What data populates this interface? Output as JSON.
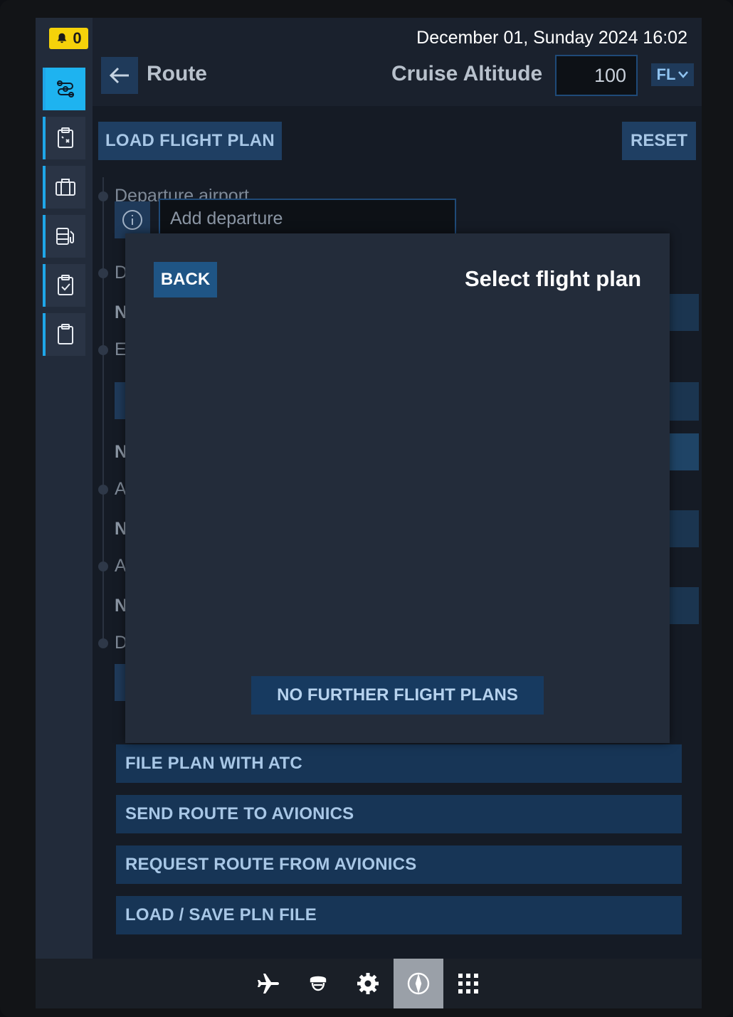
{
  "notifications": {
    "count": "0"
  },
  "header": {
    "datetime": "December 01, Sunday 2024 16:02",
    "title": "Route",
    "cruise_label": "Cruise Altitude",
    "cruise_value": "100",
    "unit": "FL"
  },
  "sidebar": {
    "items": [
      {
        "icon": "route-settings-icon",
        "active": true
      },
      {
        "icon": "clipboard-x-icon",
        "active": false
      },
      {
        "icon": "luggage-icon",
        "active": false
      },
      {
        "icon": "fuel-icon",
        "active": false
      },
      {
        "icon": "checklist-icon",
        "active": false
      },
      {
        "icon": "clipboard-icon",
        "active": false
      }
    ]
  },
  "toolbar": {
    "load_label": "LOAD FLIGHT PLAN",
    "reset_label": "RESET"
  },
  "route": {
    "departure_label": "Departure airport",
    "departure_placeholder": "Add departure",
    "partial_rows": [
      "D",
      "N",
      "E",
      "N",
      "A",
      "N",
      "A",
      "N",
      "D"
    ]
  },
  "actions": [
    "FILE PLAN WITH ATC",
    "SEND ROUTE TO AVIONICS",
    "REQUEST ROUTE FROM AVIONICS",
    "LOAD / SAVE PLN FILE"
  ],
  "dialog": {
    "back_label": "BACK",
    "title": "Select flight plan",
    "no_more_label": "NO FURTHER FLIGHT PLANS"
  },
  "bottombar": {
    "items": [
      "airplane-icon",
      "pilot-icon",
      "gear-icon",
      "compass-icon",
      "apps-grid-icon"
    ],
    "active": "compass-icon"
  },
  "colors": {
    "accent": "#1eb3f0",
    "button": "#1f3f63",
    "notification": "#f5d20a"
  }
}
